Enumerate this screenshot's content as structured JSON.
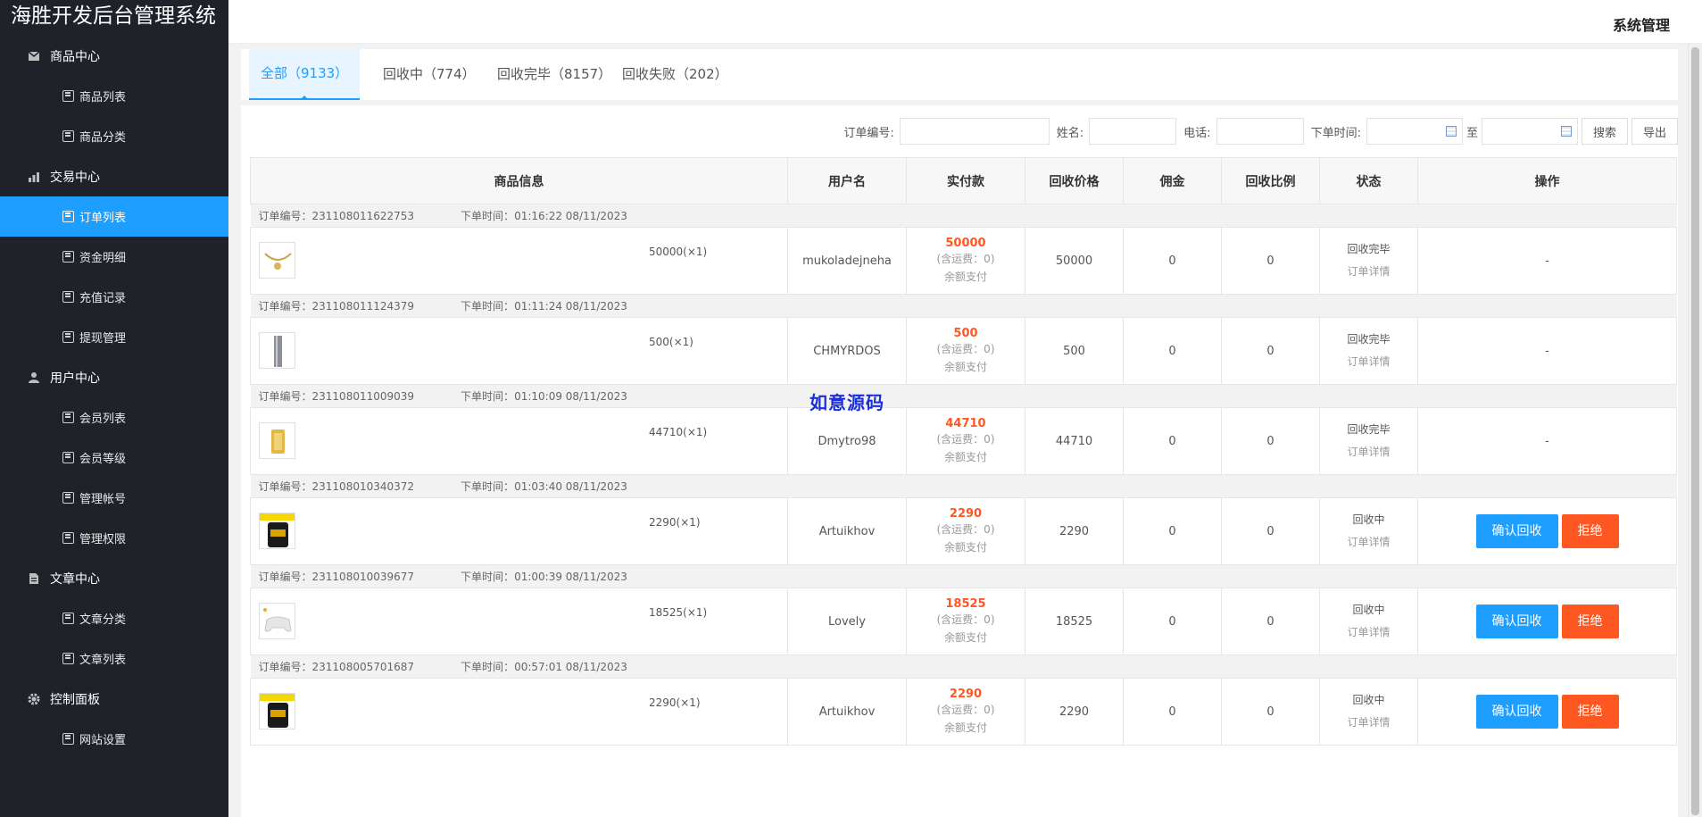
{
  "app": {
    "title": "海胜开发后台管理系统",
    "header_right": "系统管理"
  },
  "sidebar": {
    "groups": [
      {
        "label": "商品中心",
        "icon": "package-icon",
        "items": [
          "商品列表",
          "商品分类"
        ]
      },
      {
        "label": "交易中心",
        "icon": "bar-chart-icon",
        "items": [
          "订单列表",
          "资金明细",
          "充值记录",
          "提现管理"
        ]
      },
      {
        "label": "用户中心",
        "icon": "user-icon",
        "items": [
          "会员列表",
          "会员等级",
          "管理帐号",
          "管理权限"
        ]
      },
      {
        "label": "文章中心",
        "icon": "document-icon",
        "items": [
          "文章分类",
          "文章列表"
        ]
      },
      {
        "label": "控制面板",
        "icon": "gear-icon",
        "items": [
          "网站设置"
        ]
      }
    ],
    "active_item": "订单列表"
  },
  "tabs": [
    {
      "label": "全部（9133）",
      "active": true
    },
    {
      "label": "回收中（774）",
      "active": false
    },
    {
      "label": "回收完毕（8157）",
      "active": false
    },
    {
      "label": "回收失败（202）",
      "active": false
    }
  ],
  "search": {
    "order_no_label": "订单编号:",
    "name_label": "姓名:",
    "phone_label": "电话:",
    "time_label": "下单时间:",
    "to_label": "至",
    "search_button": "搜索",
    "export_button": "导出"
  },
  "table": {
    "headers": [
      "商品信息",
      "用户名",
      "实付款",
      "回收价格",
      "佣金",
      "回收比例",
      "状态",
      "操作"
    ],
    "order_no_prefix": "订单编号：",
    "order_time_prefix": "下单时间：",
    "shipping_note": "(含运费：0)",
    "pay_method": "余额支付",
    "detail_link": "订单详情",
    "confirm_button": "确认回收",
    "reject_button": "拒绝",
    "rows": [
      {
        "order_no": "231108011622753",
        "time": "01:16:22 08/11/2023",
        "goods_price": "50000(×1)",
        "user": "mukoladejneha",
        "paid": "50000",
        "recycle_price": "50000",
        "commission": "0",
        "ratio": "0",
        "status": "回收完毕",
        "action": "-",
        "thumb": "gold-necklace"
      },
      {
        "order_no": "231108011124379",
        "time": "01:11:24 08/11/2023",
        "goods_price": "500(×1)",
        "user": "CHMYRDOS",
        "paid": "500",
        "recycle_price": "500",
        "commission": "0",
        "ratio": "0",
        "status": "回收完毕",
        "action": "-",
        "thumb": "silver-bar"
      },
      {
        "order_no": "231108011009039",
        "time": "01:10:09 08/11/2023",
        "goods_price": "44710(×1)",
        "user": "Dmytro98",
        "paid": "44710",
        "recycle_price": "44710",
        "commission": "0",
        "ratio": "0",
        "status": "回收完毕",
        "action": "-",
        "thumb": "gold-bar"
      },
      {
        "order_no": "231108010340372",
        "time": "01:03:40 08/11/2023",
        "goods_price": "2290(×1)",
        "user": "Artuikhov",
        "paid": "2290",
        "recycle_price": "2290",
        "commission": "0",
        "ratio": "0",
        "status": "回收中",
        "action": "buttons",
        "thumb": "protein-tub"
      },
      {
        "order_no": "231108010039677",
        "time": "01:00:39 08/11/2023",
        "goods_price": "18525(×1)",
        "user": "Lovely",
        "paid": "18525",
        "recycle_price": "18525",
        "commission": "0",
        "ratio": "0",
        "status": "回收中",
        "action": "buttons",
        "thumb": "game-controller"
      },
      {
        "order_no": "231108005701687",
        "time": "00:57:01 08/11/2023",
        "goods_price": "2290(×1)",
        "user": "Artuikhov",
        "paid": "2290",
        "recycle_price": "2290",
        "commission": "0",
        "ratio": "0",
        "status": "回收中",
        "action": "buttons",
        "thumb": "protein-tub"
      }
    ]
  },
  "watermark": "如意源码",
  "colors": {
    "sidebar_bg": "#20222a",
    "active": "#1e9fff",
    "danger": "#ff5722"
  }
}
